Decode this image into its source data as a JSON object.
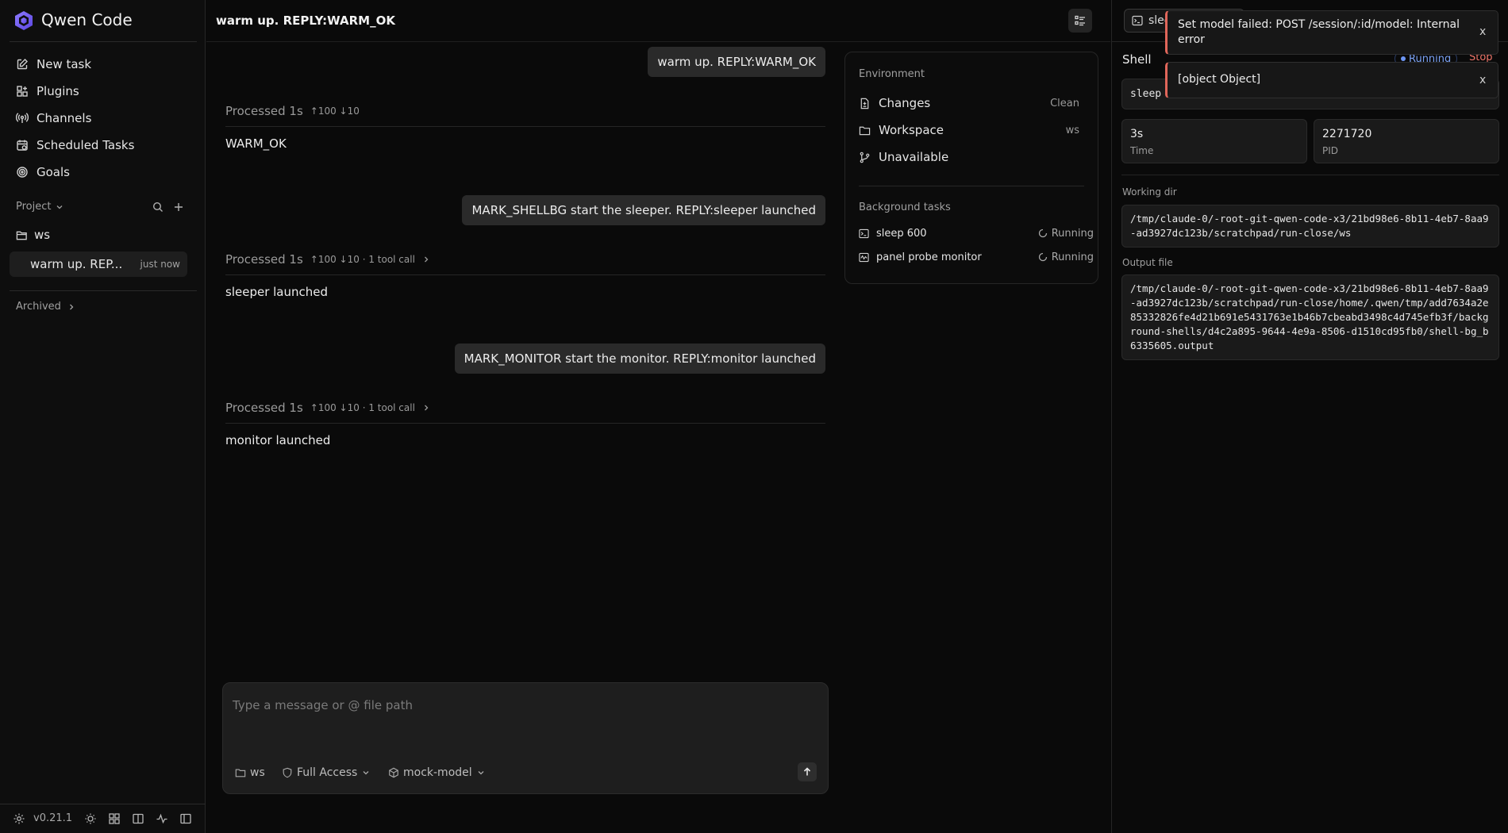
{
  "app": {
    "name": "Qwen Code",
    "version": "v0.21.1"
  },
  "sidebar": {
    "nav": [
      {
        "label": "New task",
        "icon": "edit-icon"
      },
      {
        "label": "Plugins",
        "icon": "grid-plus-icon"
      },
      {
        "label": "Channels",
        "icon": "broadcast-icon"
      },
      {
        "label": "Scheduled Tasks",
        "icon": "calendar-clock-icon"
      },
      {
        "label": "Goals",
        "icon": "target-icon"
      }
    ],
    "project_label": "Project",
    "folder": "ws",
    "session": {
      "title": "warm up. REP...",
      "time": "just now"
    },
    "archived_label": "Archived"
  },
  "header": {
    "title": "warm up. REPLY:WARM_OK"
  },
  "conversation": [
    {
      "user": "warm up. REPLY:WARM_OK",
      "processed": "Processed 1s",
      "tokens": "↑100 ↓10",
      "tool_calls": "",
      "reply": "WARM_OK"
    },
    {
      "user": "MARK_SHELLBG start the sleeper. REPLY:sleeper launched",
      "processed": "Processed 1s",
      "tokens": "↑100 ↓10 · 1 tool call",
      "tool_calls": "1 tool call",
      "reply": "sleeper launched"
    },
    {
      "user": "MARK_MONITOR start the monitor. REPLY:monitor launched",
      "processed": "Processed 1s",
      "tokens": "↑100 ↓10 · 1 tool call",
      "tool_calls": "1 tool call",
      "reply": "monitor launched"
    }
  ],
  "environment": {
    "heading": "Environment",
    "rows": [
      {
        "label": "Changes",
        "value": "Clean",
        "icon": "file-diff-icon"
      },
      {
        "label": "Workspace",
        "value": "ws",
        "icon": "folder-icon"
      },
      {
        "label": "Unavailable",
        "value": "",
        "icon": "git-branch-icon"
      }
    ],
    "bg_heading": "Background tasks",
    "bg_tasks": [
      {
        "label": "sleep 600",
        "status": "Running",
        "icon": "terminal-icon"
      },
      {
        "label": "panel probe monitor",
        "status": "Running",
        "icon": "monitor-icon"
      }
    ]
  },
  "composer": {
    "placeholder": "Type a message or @ file path",
    "folder": "ws",
    "access": "Full Access",
    "model": "mock-model"
  },
  "shell_panel": {
    "tab_label": "sleep 600",
    "title": "Shell",
    "status": "Running",
    "stop_label": "Stop",
    "command": "sleep 600",
    "time_value": "3s",
    "time_label": "Time",
    "pid_value": "2271720",
    "pid_label": "PID",
    "working_dir_label": "Working dir",
    "working_dir": "/tmp/claude-0/-root-git-qwen-code-x3/21bd98e6-8b11-4eb7-8aa9-ad3927dc123b/scratchpad/run-close/ws",
    "output_file_label": "Output file",
    "output_file": "/tmp/claude-0/-root-git-qwen-code-x3/21bd98e6-8b11-4eb7-8aa9-ad3927dc123b/scratchpad/run-close/home/.qwen/tmp/add7634a2e85332826fe4d21b691e5431763e1b46b7cbeabd3498c4d745efb3f/background-shells/d4c2a895-9644-4e9a-8506-d1510cd95fb0/shell-bg_b6335605.output"
  },
  "toasts": [
    {
      "message": "Set model failed: POST /session/:id/model: Internal error",
      "close": "x"
    },
    {
      "message": "[object Object]",
      "close": "x"
    }
  ],
  "colors": {
    "accent_blue": "#6d95f2",
    "error": "#e0665a",
    "stop": "#f0766a"
  }
}
